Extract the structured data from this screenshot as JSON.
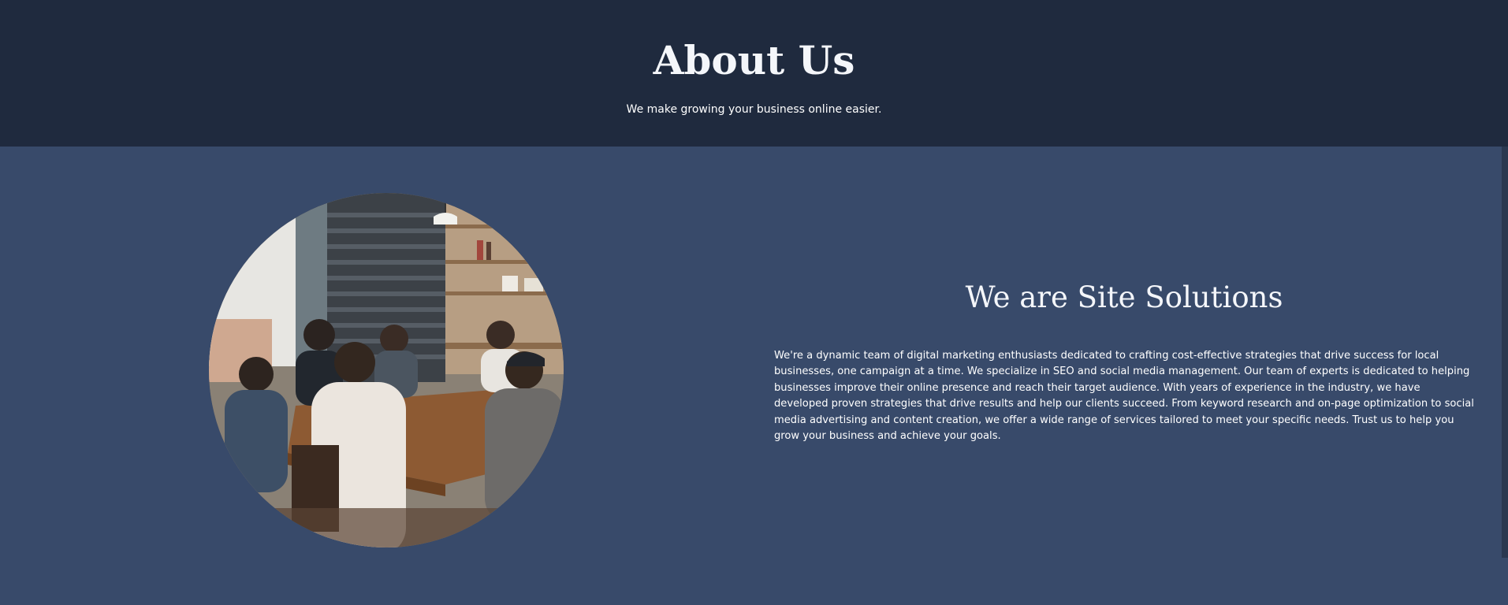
{
  "hero": {
    "title": "About Us",
    "subtitle": "We make growing your business online easier."
  },
  "about": {
    "heading": "We are Site Solutions",
    "body": "We're a dynamic team of digital marketing enthusiasts dedicated to crafting cost-effective strategies that drive success for local businesses, one campaign at a time. We specialize in SEO and social media management. Our team of experts is dedicated to helping businesses improve their online presence and reach their target audience. With years of experience in the industry, we have developed proven strategies that drive results and help our clients succeed. From keyword research and on-page optimization to social media advertising and content creation, we offer a wide range of services tailored to meet your specific needs. Trust us to help you grow your business and achieve your goals."
  },
  "colors": {
    "hero_bg": "#1f2a3e",
    "content_bg": "#384a6a",
    "text": "#ffffff"
  },
  "image": {
    "icon": "team-meeting-photo"
  }
}
